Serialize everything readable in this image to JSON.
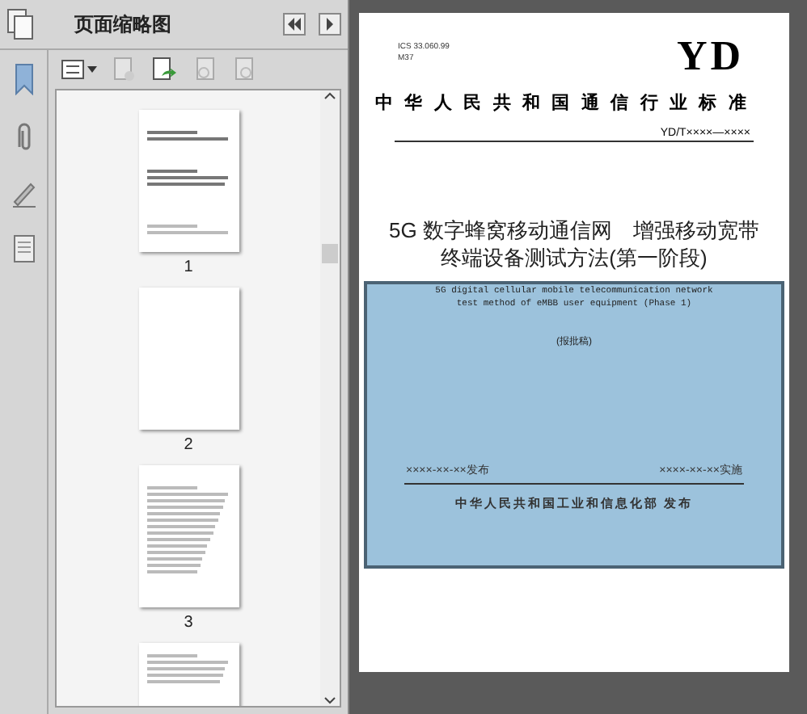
{
  "panel": {
    "title": "页面缩略图"
  },
  "thumbnails": [
    {
      "kind": "cover",
      "label": "1"
    },
    {
      "kind": "blank",
      "label": "2"
    },
    {
      "kind": "toc",
      "label": "3"
    },
    {
      "kind": "list"
    }
  ],
  "document": {
    "ics": "ICS 33.060.99",
    "ccs": "M37",
    "logo": "YD",
    "standard_title": "中华人民共和国通信行业标准",
    "number": "YD/T××××—××××",
    "title_lines": [
      "5G 数字蜂窝移动通信网　增强移动宽带",
      "终端设备测试方法(第一阶段)"
    ],
    "english_lines": [
      "5G digital cellular mobile telecommunication network",
      "test method of eMBB user equipment (Phase 1)"
    ],
    "draft": "(报批稿)",
    "publish_date": "××××-××-××发布",
    "effective_date": "××××-××-××实施",
    "publisher": "中华人民共和国工业和信息化部 发布"
  }
}
